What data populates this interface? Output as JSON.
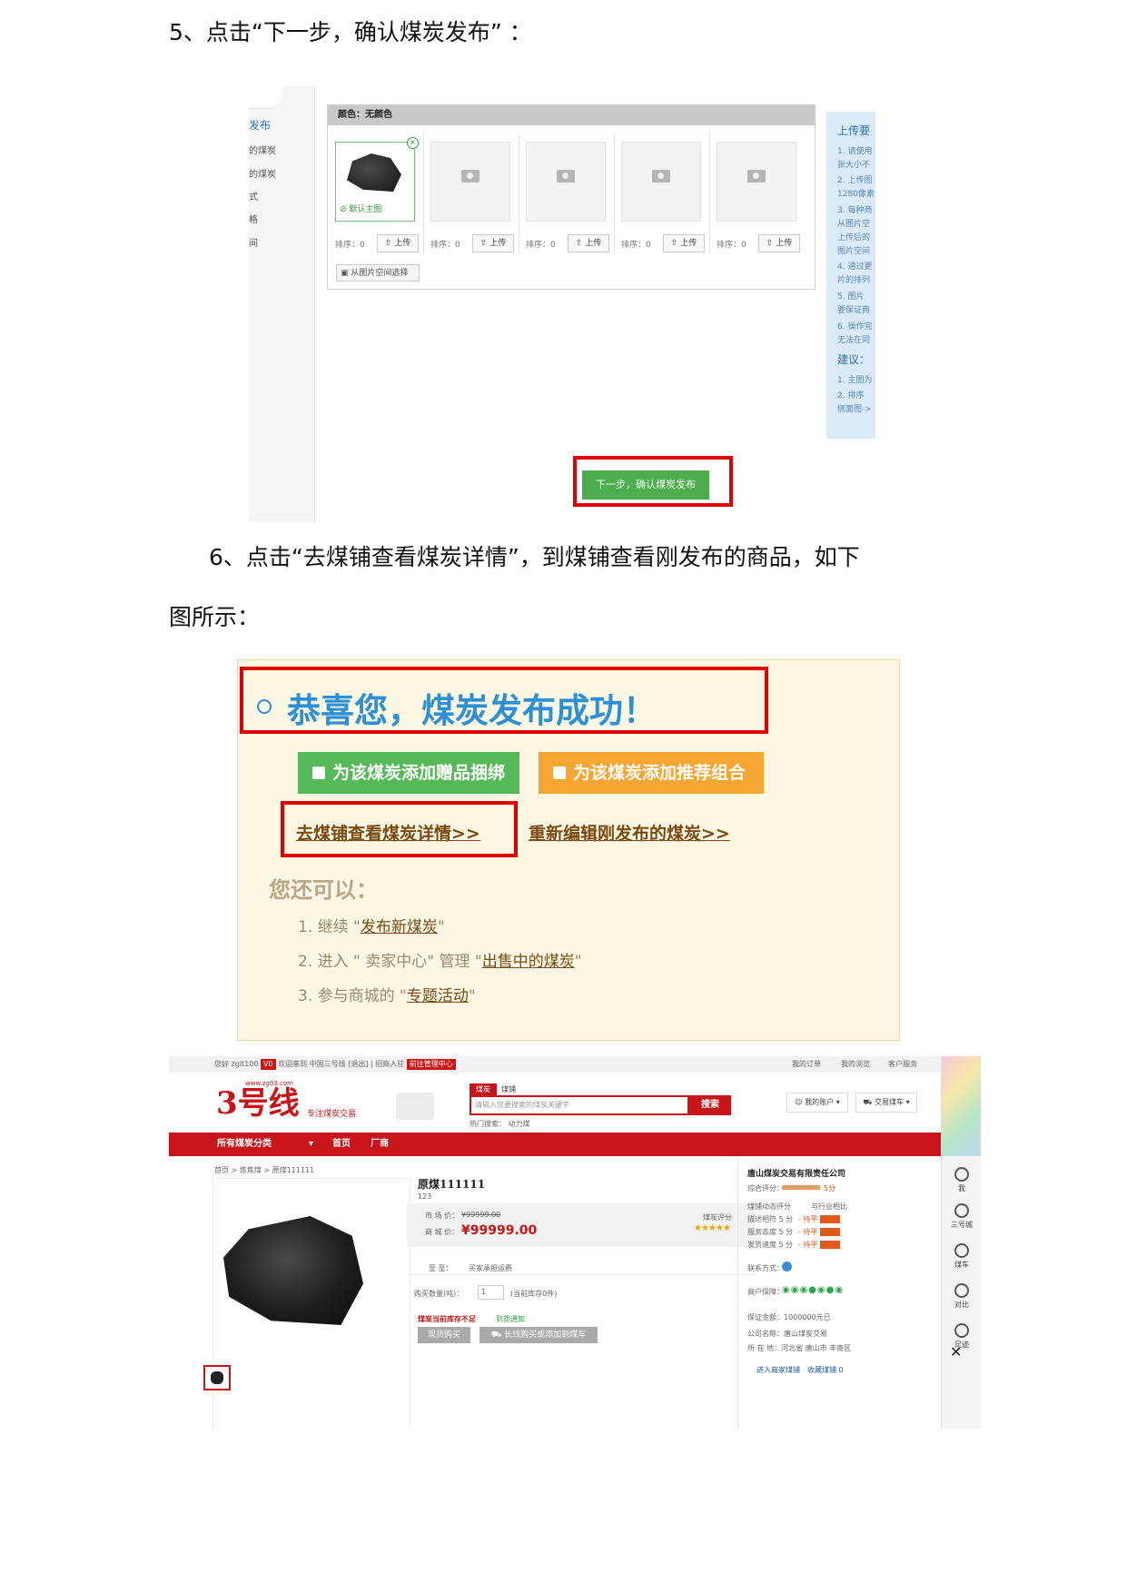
{
  "step5": {
    "text": "5、点击“下一步，确认煤炭发布”   ："
  },
  "shot1": {
    "left_menu": [
      "发布",
      "的煤炭",
      "的煤炭",
      "式",
      "格",
      "间"
    ],
    "panel_title": "颜色：无颜色",
    "default_main_label": "默认主图",
    "sort_label": "排序：0",
    "upload_label": "上传",
    "space_select_label": "从图片空间选择",
    "tips": {
      "title": "上传要",
      "lines": [
        "1. 请使用",
        "张大小不",
        "2. 上传图",
        "1280像素",
        "3. 每种商",
        "从图片空",
        "上传后的",
        "图片空间",
        "4. 通过更",
        "片的排列",
        "5. 图片",
        "要保证商",
        "6. 操作完",
        "无法在同"
      ],
      "advice_title": "建议：",
      "advice_lines": [
        "1. 主图为",
        "2. 排序",
        "侧面图->"
      ]
    },
    "next_button": "下一步，确认煤炭发布"
  },
  "step6": {
    "line1": "6、点击“去煤铺查看煤炭详情”，到煤铺查看刚发布的商品，如下",
    "line2": "图所示："
  },
  "shot2": {
    "title": "恭喜您，煤炭发布成功！",
    "btn_gift": "为该煤炭添加赠品捆绑",
    "btn_combo": "为该煤炭添加推荐组合",
    "link_view": "去煤铺查看煤炭详情>>",
    "link_edit": "重新编辑刚发布的煤炭>>",
    "also_title": "您还可以：",
    "options": [
      {
        "prefix": "1. 继续 \"",
        "link": "发布新煤炭",
        "suffix": "\""
      },
      {
        "prefix": "2. 进入 \" 卖家中心\" 管理 \"",
        "link": "出售中的煤炭",
        "suffix": "\""
      },
      {
        "prefix": "3. 参与商城的 \"",
        "link": "专题活动",
        "suffix": "\""
      }
    ]
  },
  "shot3": {
    "topbar": {
      "greeting": "您好 zglt100",
      "vip": "V0",
      "welcome": "欢迎来到 中国三号线 [退出] | 招商入驻",
      "seller_center": "前往管理中心",
      "my_orders": "我的订单",
      "my_browse": "我的浏览",
      "customer_service": "客户服务"
    },
    "logo_text": "3号线",
    "logo_url": "www.zg03.com",
    "slogan": "专注煤炭交易",
    "search_tabs": [
      "煤炭",
      "煤铺"
    ],
    "search_placeholder": "请输入您要搜索的煤炭关键字",
    "search_button": "搜索",
    "hot_search": "热门搜索：  动力煤",
    "my_account": "我的账户",
    "trade_cart": "交易煤车",
    "nav": {
      "all_categories": "所有煤炭分类",
      "home": "首页",
      "factory": "厂商"
    },
    "breadcrumb": "首页  >  炼焦煤  >  原煤111111",
    "product": {
      "title": "原煤111111",
      "subtitle": "123",
      "market_price_label": "市 场 价：",
      "market_price": "¥99999.00",
      "shop_price_label": "商 城 价：",
      "shop_price": "¥99999.00",
      "rating_label": "煤炭评分",
      "stars": "★★★★★",
      "delivery_label": "至     至：",
      "delivery_value": "买家承担运费",
      "qty_label": "购买数量(吨)：",
      "qty_value": "1",
      "stock_note": "(当前库存0件)",
      "stock_warning": "煤炭当前库存不足",
      "arrival_notice": "到货通知",
      "buy_now": "现货购买",
      "add_cart": "长线购买或添加到煤车"
    },
    "shop": {
      "name": "唐山煤炭交易有限责任公司",
      "overall": "综合评分：",
      "overall_score": "5分",
      "dynamic": "煤铺动态评分",
      "compare": "与行业相比",
      "scores": [
        "描述相符  5 分",
        "服务态度  5 分",
        "发货速度  5 分"
      ],
      "trend": "- 持平",
      "contact": "联系方式：",
      "guarantee_label": "商户保障：",
      "deposit": "保证金额：1000000元已",
      "company": "公司名称：唐山煤炭交易",
      "location": "所 在 地：河北省 唐山市 丰南区",
      "enter_shop": "进入商家煤铺",
      "fav_shop": "收藏煤铺 0"
    },
    "sidebar": [
      "我",
      "三号城",
      "煤车",
      "对比",
      "足迹"
    ]
  }
}
